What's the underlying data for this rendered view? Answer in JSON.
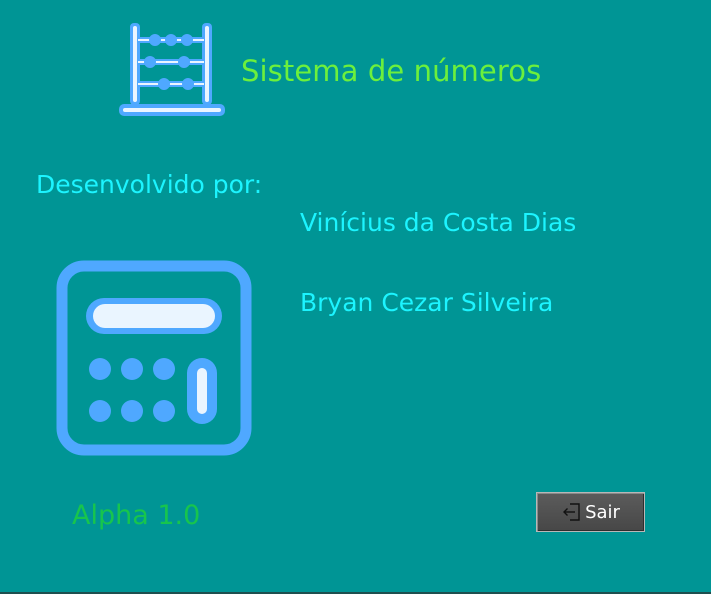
{
  "header": {
    "title": "Sistema de números",
    "icon": "abacus-icon"
  },
  "credits": {
    "label": "Desenvolvido por:",
    "developers": [
      "Vinícius da Costa Dias",
      "Bryan Cezar Silveira"
    ]
  },
  "illustration": {
    "icon": "calculator-icon"
  },
  "footer": {
    "version": "Alpha 1.0",
    "exit_button": {
      "label": "Sair",
      "icon": "exit-icon"
    }
  },
  "colors": {
    "background": "#009595",
    "title": "#6cf03c",
    "text": "#1cf4ff",
    "version": "#17c54d",
    "icon_blue": "#4fa8ff",
    "icon_light": "#eaf5ff",
    "button": "#4f4f4f"
  }
}
